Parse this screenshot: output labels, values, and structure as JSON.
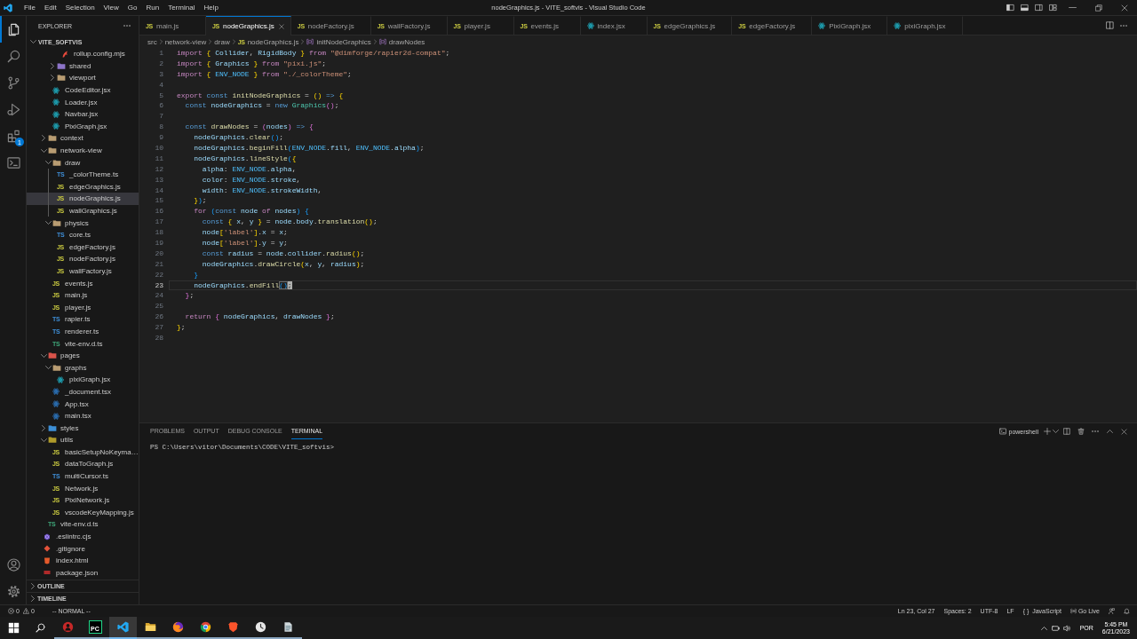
{
  "title_bar": {
    "menu": [
      "File",
      "Edit",
      "Selection",
      "View",
      "Go",
      "Run",
      "Terminal",
      "Help"
    ],
    "title": "nodeGraphics.js - VITE_softvis - Visual Studio Code"
  },
  "activity_bar": {
    "items": [
      {
        "kind": "explorer",
        "selected": true
      },
      {
        "kind": "search",
        "selected": false
      },
      {
        "kind": "source-control",
        "selected": false
      },
      {
        "kind": "run",
        "selected": false
      },
      {
        "kind": "extensions",
        "selected": false,
        "badge": "1"
      },
      {
        "kind": "terminal",
        "selected": false
      }
    ],
    "bottom": [
      {
        "kind": "account"
      },
      {
        "kind": "settings"
      }
    ]
  },
  "sidebar": {
    "title": "EXPLORER",
    "section": {
      "title": "VITE_SOFTVIS",
      "expanded": true
    },
    "tree": [
      {
        "children": [
          {
            "children": [
              {
                "children": [
                  {
                    "children": [
                      {
                        "label": "rollup.config.mjs",
                        "kind": "rollup",
                        "selected": false
                      }
                    ]
                  },
                  {
                    "label": "shared",
                    "kind": "shared-folder",
                    "expanded": false,
                    "selected": false
                  },
                  {
                    "label": "viewport",
                    "kind": "folder",
                    "expanded": false,
                    "selected": false
                  }
                ]
              },
              {
                "label": "CodeEditor.jsx",
                "kind": "react",
                "selected": false
              },
              {
                "label": "Loader.jsx",
                "kind": "react",
                "selected": false
              },
              {
                "label": "Navbar.jsx",
                "kind": "react",
                "selected": false
              },
              {
                "label": "PixiGraph.jsx",
                "kind": "react",
                "selected": false
              }
            ]
          },
          {
            "label": "context",
            "kind": "folder",
            "expanded": false,
            "selected": false
          },
          {
            "label": "network-view",
            "kind": "folder",
            "expanded": true,
            "selected": false,
            "children": [
              {
                "label": "draw",
                "kind": "folder",
                "expanded": true,
                "selected": false,
                "children": [
                  {
                    "label": "_colorTheme.ts",
                    "kind": "ts",
                    "icon_text": "TS",
                    "selected": false
                  },
                  {
                    "label": "edgeGraphics.js",
                    "kind": "js",
                    "icon_text": "JS",
                    "selected": false
                  },
                  {
                    "label": "nodeGraphics.js",
                    "kind": "js",
                    "icon_text": "JS",
                    "selected": true
                  },
                  {
                    "label": "wallGraphics.js",
                    "kind": "js",
                    "icon_text": "JS",
                    "selected": false
                  }
                ]
              },
              {
                "label": "physics",
                "kind": "folder",
                "expanded": true,
                "selected": false,
                "children": [
                  {
                    "label": "core.ts",
                    "kind": "ts",
                    "icon_text": "TS",
                    "selected": false
                  },
                  {
                    "label": "edgeFactory.js",
                    "kind": "js",
                    "icon_text": "JS",
                    "selected": false
                  },
                  {
                    "label": "nodeFactory.js",
                    "kind": "js",
                    "icon_text": "JS",
                    "selected": false
                  },
                  {
                    "label": "wallFactory.js",
                    "kind": "js",
                    "icon_text": "JS",
                    "selected": false
                  }
                ]
              },
              {
                "label": "events.js",
                "kind": "js",
                "icon_text": "JS",
                "selected": false
              },
              {
                "label": "main.js",
                "kind": "js",
                "icon_text": "JS",
                "selected": false
              },
              {
                "label": "player.js",
                "kind": "js",
                "icon_text": "JS",
                "selected": false
              },
              {
                "label": "rapier.ts",
                "kind": "ts",
                "icon_text": "TS",
                "selected": false
              },
              {
                "label": "renderer.ts",
                "kind": "ts",
                "icon_text": "TS",
                "selected": false
              },
              {
                "label": "vite-env.d.ts",
                "kind": "dts",
                "icon_text": "TS",
                "selected": false
              }
            ]
          },
          {
            "label": "pages",
            "kind": "pages-folder",
            "expanded": true,
            "selected": false,
            "children": [
              {
                "label": "graphs",
                "kind": "folder",
                "expanded": true,
                "selected": false,
                "children": [
                  {
                    "label": "pixiGraph.jsx",
                    "kind": "react",
                    "selected": false
                  }
                ]
              },
              {
                "label": "_document.tsx",
                "kind": "react-ts",
                "selected": false
              },
              {
                "label": "App.tsx",
                "kind": "react-ts",
                "selected": false
              },
              {
                "label": "main.tsx",
                "kind": "react-ts",
                "selected": false
              }
            ]
          },
          {
            "label": "styles",
            "kind": "styles-folder",
            "expanded": false,
            "selected": false
          },
          {
            "label": "utils",
            "kind": "utils-folder",
            "expanded": true,
            "selected": false,
            "children": [
              {
                "label": "basicSetupNoKeyma…",
                "kind": "js",
                "icon_text": "JS",
                "selected": false
              },
              {
                "label": "dataToGraph.js",
                "kind": "js",
                "icon_text": "JS",
                "selected": false
              },
              {
                "label": "multiCursor.ts",
                "kind": "ts",
                "icon_text": "TS",
                "selected": false
              },
              {
                "label": "Network.js",
                "kind": "js",
                "icon_text": "JS",
                "selected": false
              },
              {
                "label": "PixiNetwork.js",
                "kind": "js",
                "icon_text": "JS",
                "selected": false
              },
              {
                "label": "vscodeKeyMapping.js",
                "kind": "js",
                "icon_text": "JS",
                "selected": false
              }
            ]
          },
          {
            "label": "vite-env.d.ts",
            "kind": "dts",
            "icon_text": "TS",
            "selected": false
          }
        ]
      },
      {
        "label": ".eslintrc.cjs",
        "kind": "eslint",
        "selected": false
      },
      {
        "label": ".gitignore",
        "kind": "git",
        "selected": false
      },
      {
        "label": "index.html",
        "kind": "html",
        "selected": false
      },
      {
        "label": "package.json",
        "kind": "package",
        "selected": false
      }
    ],
    "panes": [
      {
        "title": "OUTLINE",
        "expanded": false
      },
      {
        "title": "TIMELINE",
        "expanded": false
      }
    ]
  },
  "editor": {
    "tabs": [
      {
        "label": "main.js",
        "kind": "js",
        "icon_text": "JS",
        "selected": false
      },
      {
        "label": "nodeGraphics.js",
        "kind": "js",
        "icon_text": "JS",
        "selected": true
      },
      {
        "label": "nodeFactory.js",
        "kind": "js",
        "icon_text": "JS",
        "selected": false
      },
      {
        "label": "wallFactory.js",
        "kind": "js",
        "icon_text": "JS",
        "selected": false
      },
      {
        "label": "player.js",
        "kind": "js",
        "icon_text": "JS",
        "selected": false
      },
      {
        "label": "events.js",
        "kind": "js",
        "icon_text": "JS",
        "selected": false
      },
      {
        "label": "index.jsx",
        "kind": "react",
        "selected": false
      },
      {
        "label": "edgeGraphics.js",
        "kind": "js",
        "icon_text": "JS",
        "selected": false
      },
      {
        "label": "edgeFactory.js",
        "kind": "js",
        "icon_text": "JS",
        "selected": false
      },
      {
        "label": "PixiGraph.jsx",
        "kind": "react",
        "selected": false
      },
      {
        "label": "pixiGraph.jsx",
        "kind": "react",
        "selected": false
      }
    ],
    "breadcrumb": [
      {
        "label": "src"
      },
      {
        "label": "network-view"
      },
      {
        "label": "draw"
      },
      {
        "label": "nodeGraphics.js",
        "kind": "js",
        "icon_text": "JS"
      },
      {
        "label": "initNodeGraphics",
        "kind": "symbol"
      },
      {
        "label": "drawNodes",
        "kind": "symbol"
      }
    ],
    "lines": [
      {
        "number": "1",
        "current": false,
        "tokens": [
          {
            "text": "import ",
            "kind": "keyword"
          },
          {
            "text": "{",
            "kind": "bracket1"
          },
          {
            "text": " Collider",
            "kind": "variable"
          },
          {
            "text": ", ",
            "kind": "punctuation"
          },
          {
            "text": "RigidBody ",
            "kind": "variable"
          },
          {
            "text": "}",
            "kind": "bracket1"
          },
          {
            "text": " from ",
            "kind": "keyword"
          },
          {
            "text": "\"@dimforge/rapier2d-compat\"",
            "kind": "string"
          },
          {
            "text": ";",
            "kind": "punctuation"
          }
        ]
      },
      {
        "number": "2",
        "current": false,
        "tokens": [
          {
            "text": "import ",
            "kind": "keyword"
          },
          {
            "text": "{",
            "kind": "bracket1"
          },
          {
            "text": " Graphics ",
            "kind": "variable"
          },
          {
            "text": "}",
            "kind": "bracket1"
          },
          {
            "text": " from ",
            "kind": "keyword"
          },
          {
            "text": "\"pixi.js\"",
            "kind": "string"
          },
          {
            "text": ";",
            "kind": "punctuation"
          }
        ]
      },
      {
        "number": "3",
        "current": false,
        "tokens": [
          {
            "text": "import ",
            "kind": "keyword"
          },
          {
            "text": "{",
            "kind": "bracket1"
          },
          {
            "text": " ENV_NODE ",
            "kind": "constant"
          },
          {
            "text": "}",
            "kind": "bracket1"
          },
          {
            "text": " from ",
            "kind": "keyword"
          },
          {
            "text": "\"./_colorTheme\"",
            "kind": "string"
          },
          {
            "text": ";",
            "kind": "punctuation"
          }
        ]
      },
      {
        "number": "4",
        "current": false
      },
      {
        "number": "5",
        "current": false,
        "tokens": [
          {
            "text": "export ",
            "kind": "keyword"
          },
          {
            "text": "const ",
            "kind": "storage"
          },
          {
            "text": "initNodeGraphics",
            "kind": "function"
          },
          {
            "text": " = ",
            "kind": "punctuation"
          },
          {
            "text": "()",
            "kind": "bracket1"
          },
          {
            "text": " => ",
            "kind": "storage"
          },
          {
            "text": "{",
            "kind": "bracket1"
          }
        ]
      },
      {
        "number": "6",
        "current": false,
        "tokens": [
          {
            "text": "  const ",
            "kind": "storage"
          },
          {
            "text": "nodeGraphics",
            "kind": "variable"
          },
          {
            "text": " = ",
            "kind": "punctuation"
          },
          {
            "text": "new ",
            "kind": "storage"
          },
          {
            "text": "Graphics",
            "kind": "class"
          },
          {
            "text": "()",
            "kind": "bracket2"
          },
          {
            "text": ";",
            "kind": "punctuation"
          }
        ]
      },
      {
        "number": "7",
        "current": false
      },
      {
        "number": "8",
        "current": false,
        "tokens": [
          {
            "text": "  const ",
            "kind": "storage"
          },
          {
            "text": "drawNodes",
            "kind": "function"
          },
          {
            "text": " = ",
            "kind": "punctuation"
          },
          {
            "text": "(",
            "kind": "bracket2"
          },
          {
            "text": "nodes",
            "kind": "variable"
          },
          {
            "text": ")",
            "kind": "bracket2"
          },
          {
            "text": " => ",
            "kind": "storage"
          },
          {
            "text": "{",
            "kind": "bracket2"
          }
        ]
      },
      {
        "number": "9",
        "current": false,
        "tokens": [
          {
            "text": "    nodeGraphics",
            "kind": "variable"
          },
          {
            "text": ".",
            "kind": "punctuation"
          },
          {
            "text": "clear",
            "kind": "function"
          },
          {
            "text": "()",
            "kind": "bracket3"
          },
          {
            "text": ";",
            "kind": "punctuation"
          }
        ]
      },
      {
        "number": "10",
        "current": false,
        "tokens": [
          {
            "text": "    nodeGraphics",
            "kind": "variable"
          },
          {
            "text": ".",
            "kind": "punctuation"
          },
          {
            "text": "beginFill",
            "kind": "function"
          },
          {
            "text": "(",
            "kind": "bracket3"
          },
          {
            "text": "ENV_NODE",
            "kind": "constant"
          },
          {
            "text": ".",
            "kind": "punctuation"
          },
          {
            "text": "fill",
            "kind": "variable"
          },
          {
            "text": ", ",
            "kind": "punctuation"
          },
          {
            "text": "ENV_NODE",
            "kind": "constant"
          },
          {
            "text": ".",
            "kind": "punctuation"
          },
          {
            "text": "alpha",
            "kind": "variable"
          },
          {
            "text": ")",
            "kind": "bracket3"
          },
          {
            "text": ";",
            "kind": "punctuation"
          }
        ]
      },
      {
        "number": "11",
        "current": false,
        "tokens": [
          {
            "text": "    nodeGraphics",
            "kind": "variable"
          },
          {
            "text": ".",
            "kind": "punctuation"
          },
          {
            "text": "lineStyle",
            "kind": "function"
          },
          {
            "text": "(",
            "kind": "bracket3"
          },
          {
            "text": "{",
            "kind": "bracket1"
          }
        ]
      },
      {
        "number": "12",
        "current": false,
        "tokens": [
          {
            "text": "      alpha",
            "kind": "variable"
          },
          {
            "text": ": ",
            "kind": "punctuation"
          },
          {
            "text": "ENV_NODE",
            "kind": "constant"
          },
          {
            "text": ".",
            "kind": "punctuation"
          },
          {
            "text": "alpha",
            "kind": "variable"
          },
          {
            "text": ",",
            "kind": "punctuation"
          }
        ]
      },
      {
        "number": "13",
        "current": false,
        "tokens": [
          {
            "text": "      color",
            "kind": "variable"
          },
          {
            "text": ": ",
            "kind": "punctuation"
          },
          {
            "text": "ENV_NODE",
            "kind": "constant"
          },
          {
            "text": ".",
            "kind": "punctuation"
          },
          {
            "text": "stroke",
            "kind": "variable"
          },
          {
            "text": ",",
            "kind": "punctuation"
          }
        ]
      },
      {
        "number": "14",
        "current": false,
        "tokens": [
          {
            "text": "      width",
            "kind": "variable"
          },
          {
            "text": ": ",
            "kind": "punctuation"
          },
          {
            "text": "ENV_NODE",
            "kind": "constant"
          },
          {
            "text": ".",
            "kind": "punctuation"
          },
          {
            "text": "strokeWidth",
            "kind": "variable"
          },
          {
            "text": ",",
            "kind": "punctuation"
          }
        ]
      },
      {
        "number": "15",
        "current": false,
        "tokens": [
          {
            "text": "    }",
            "kind": "bracket1"
          },
          {
            "text": ")",
            "kind": "bracket3"
          },
          {
            "text": ";",
            "kind": "punctuation"
          }
        ]
      },
      {
        "number": "16",
        "current": false,
        "tokens": [
          {
            "text": "    for ",
            "kind": "keyword"
          },
          {
            "text": "(",
            "kind": "bracket3"
          },
          {
            "text": "const ",
            "kind": "storage"
          },
          {
            "text": "node",
            "kind": "variable"
          },
          {
            "text": " of ",
            "kind": "keyword"
          },
          {
            "text": "nodes",
            "kind": "variable"
          },
          {
            "text": ") ",
            "kind": "bracket3"
          },
          {
            "text": "{",
            "kind": "bracket3"
          }
        ]
      },
      {
        "number": "17",
        "current": false,
        "tokens": [
          {
            "text": "      const ",
            "kind": "storage"
          },
          {
            "text": "{",
            "kind": "bracket1"
          },
          {
            "text": " x",
            "kind": "variable"
          },
          {
            "text": ", ",
            "kind": "punctuation"
          },
          {
            "text": "y ",
            "kind": "variable"
          },
          {
            "text": "}",
            "kind": "bracket1"
          },
          {
            "text": " = ",
            "kind": "punctuation"
          },
          {
            "text": "node",
            "kind": "variable"
          },
          {
            "text": ".",
            "kind": "punctuation"
          },
          {
            "text": "body",
            "kind": "variable"
          },
          {
            "text": ".",
            "kind": "punctuation"
          },
          {
            "text": "translation",
            "kind": "function"
          },
          {
            "text": "()",
            "kind": "bracket1"
          },
          {
            "text": ";",
            "kind": "punctuation"
          }
        ]
      },
      {
        "number": "18",
        "current": false,
        "tokens": [
          {
            "text": "      node",
            "kind": "variable"
          },
          {
            "text": "[",
            "kind": "bracket1"
          },
          {
            "text": "'label'",
            "kind": "string"
          },
          {
            "text": "]",
            "kind": "bracket1"
          },
          {
            "text": ".",
            "kind": "punctuation"
          },
          {
            "text": "x",
            "kind": "variable"
          },
          {
            "text": " = ",
            "kind": "punctuation"
          },
          {
            "text": "x",
            "kind": "variable"
          },
          {
            "text": ";",
            "kind": "punctuation"
          }
        ]
      },
      {
        "number": "19",
        "current": false,
        "tokens": [
          {
            "text": "      node",
            "kind": "variable"
          },
          {
            "text": "[",
            "kind": "bracket1"
          },
          {
            "text": "'label'",
            "kind": "string"
          },
          {
            "text": "]",
            "kind": "bracket1"
          },
          {
            "text": ".",
            "kind": "punctuation"
          },
          {
            "text": "y",
            "kind": "variable"
          },
          {
            "text": " = ",
            "kind": "punctuation"
          },
          {
            "text": "y",
            "kind": "variable"
          },
          {
            "text": ";",
            "kind": "punctuation"
          }
        ]
      },
      {
        "number": "20",
        "current": false,
        "tokens": [
          {
            "text": "      const ",
            "kind": "storage"
          },
          {
            "text": "radius",
            "kind": "variable"
          },
          {
            "text": " = ",
            "kind": "punctuation"
          },
          {
            "text": "node",
            "kind": "variable"
          },
          {
            "text": ".",
            "kind": "punctuation"
          },
          {
            "text": "collider",
            "kind": "variable"
          },
          {
            "text": ".",
            "kind": "punctuation"
          },
          {
            "text": "radius",
            "kind": "function"
          },
          {
            "text": "()",
            "kind": "bracket1"
          },
          {
            "text": ";",
            "kind": "punctuation"
          }
        ]
      },
      {
        "number": "21",
        "current": false,
        "tokens": [
          {
            "text": "      nodeGraphics",
            "kind": "variable"
          },
          {
            "text": ".",
            "kind": "punctuation"
          },
          {
            "text": "drawCircle",
            "kind": "function"
          },
          {
            "text": "(",
            "kind": "bracket1"
          },
          {
            "text": "x",
            "kind": "variable"
          },
          {
            "text": ", ",
            "kind": "punctuation"
          },
          {
            "text": "y",
            "kind": "variable"
          },
          {
            "text": ", ",
            "kind": "punctuation"
          },
          {
            "text": "radius",
            "kind": "variable"
          },
          {
            "text": ")",
            "kind": "bracket1"
          },
          {
            "text": ";",
            "kind": "punctuation"
          }
        ]
      },
      {
        "number": "22",
        "current": false,
        "tokens": [
          {
            "text": "    }",
            "kind": "bracket3"
          }
        ]
      },
      {
        "number": "23",
        "current": true,
        "tokens": [
          {
            "text": "    nodeGraphics",
            "kind": "variable"
          },
          {
            "text": ".",
            "kind": "punctuation"
          },
          {
            "text": "endFill",
            "kind": "function"
          },
          {
            "text": "()",
            "kind": "match"
          },
          {
            "text": ";",
            "kind": "cursor"
          }
        ]
      },
      {
        "number": "24",
        "current": false,
        "tokens": [
          {
            "text": "  }",
            "kind": "bracket2"
          },
          {
            "text": ";",
            "kind": "punctuation"
          }
        ]
      },
      {
        "number": "25",
        "current": false
      },
      {
        "number": "26",
        "current": false,
        "tokens": [
          {
            "text": "  return ",
            "kind": "keyword"
          },
          {
            "text": "{",
            "kind": "bracket2"
          },
          {
            "text": " nodeGraphics",
            "kind": "variable"
          },
          {
            "text": ", ",
            "kind": "punctuation"
          },
          {
            "text": "drawNodes ",
            "kind": "variable"
          },
          {
            "text": "}",
            "kind": "bracket2"
          },
          {
            "text": ";",
            "kind": "punctuation"
          }
        ]
      },
      {
        "number": "27",
        "current": false,
        "tokens": [
          {
            "text": "}",
            "kind": "bracket1"
          },
          {
            "text": ";",
            "kind": "punctuation"
          }
        ]
      },
      {
        "number": "28",
        "current": false
      }
    ]
  },
  "panel": {
    "tabs": [
      {
        "label": "PROBLEMS",
        "selected": false
      },
      {
        "label": "OUTPUT",
        "selected": false
      },
      {
        "label": "DEBUG CONSOLE",
        "selected": false
      },
      {
        "label": "TERMINAL",
        "selected": true
      }
    ],
    "terminal": {
      "name": "powershell",
      "lines": [
        "PS C:\\Users\\vitor\\Documents\\CODE\\VITE_softvis>"
      ]
    }
  },
  "status_bar": {
    "left": [
      {
        "kind": "errors",
        "text": "0"
      },
      {
        "kind": "warnings",
        "text": "0"
      },
      {
        "kind": "mode",
        "text": "-- NORMAL --"
      }
    ],
    "right": [
      {
        "kind": "text",
        "text": "Ln 23, Col 27"
      },
      {
        "kind": "text",
        "text": "Spaces: 2"
      },
      {
        "kind": "text",
        "text": "UTF-8"
      },
      {
        "kind": "text",
        "text": "LF"
      },
      {
        "kind": "language",
        "icon_text": "{ }",
        "text": "JavaScript"
      },
      {
        "kind": "live",
        "text": "Go Live"
      },
      {
        "kind": "feedback"
      },
      {
        "kind": "bell"
      }
    ]
  },
  "taskbar": {
    "apps": [
      {
        "kind": "figure",
        "selected": false,
        "running": true
      },
      {
        "kind": "letters",
        "label": "PC",
        "selected": false,
        "running": true
      },
      {
        "kind": "editor",
        "selected": true,
        "running": true
      },
      {
        "kind": "folder",
        "selected": false,
        "running": true
      },
      {
        "kind": "fox",
        "selected": false,
        "running": true
      },
      {
        "kind": "chrome",
        "selected": false,
        "running": true
      },
      {
        "kind": "brave",
        "selected": false,
        "running": true
      },
      {
        "kind": "clock",
        "selected": false,
        "running": true
      },
      {
        "kind": "stack",
        "selected": false,
        "running": true
      }
    ],
    "tray": {
      "language": "POR",
      "time": "5:45 PM",
      "date": "6/21/2023"
    }
  }
}
